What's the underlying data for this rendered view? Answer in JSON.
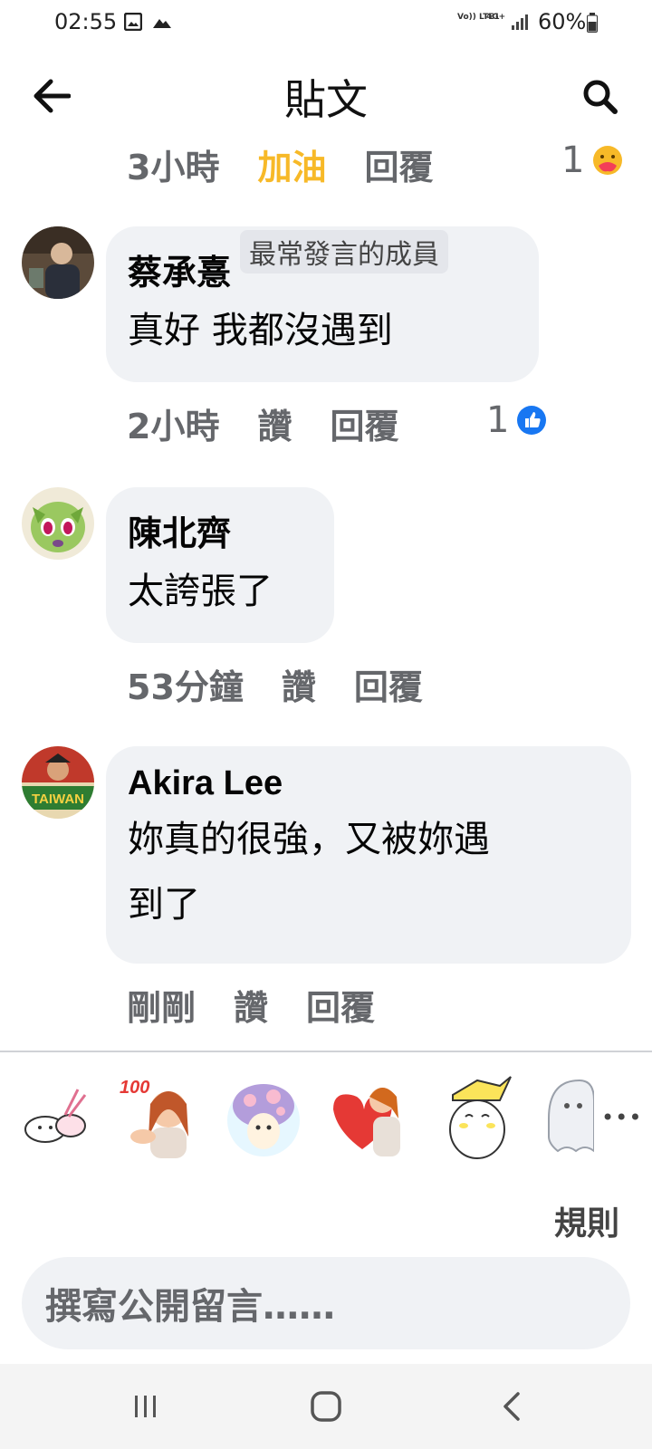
{
  "status_bar": {
    "time": "02:55",
    "volte": "Vo)) LTE1",
    "network": "4G+",
    "battery": "60%"
  },
  "header": {
    "title": "貼文"
  },
  "top_actions": {
    "time": "3小時",
    "reaction": "加油",
    "reply": "回覆",
    "reaction_count": "1",
    "reaction_icon": "care-reaction-icon"
  },
  "comments": [
    {
      "author": "蔡承憙",
      "badge": "最常發言的成員",
      "text": "真好 我都沒遇到",
      "time": "2小時",
      "like": "讚",
      "reply": "回覆",
      "reaction_count": "1",
      "reaction_icon": "like-reaction-icon"
    },
    {
      "author": "陳北齊",
      "text": "太誇張了",
      "time": "53分鐘",
      "like": "讚",
      "reply": "回覆"
    },
    {
      "author": "Akira Lee",
      "text_line1": "妳真的很強，又被妳遇",
      "text_line2": "到了",
      "time": "剛剛",
      "like": "讚",
      "reply": "回覆",
      "avatar_text": "TAIWAN"
    }
  ],
  "sticker_bar": {
    "more": "•••",
    "sticker_100_label": "100"
  },
  "rules_label": "規則",
  "comment_input": {
    "placeholder": "撰寫公開留言……"
  },
  "colors": {
    "accent_cheer": "#f7b928",
    "like_blue": "#1877f2",
    "bubble_bg": "#f0f2f5",
    "muted_text": "#65676b"
  }
}
